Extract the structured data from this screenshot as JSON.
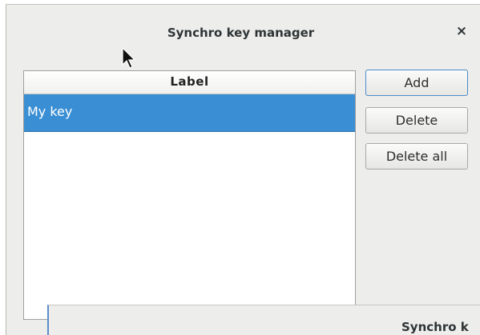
{
  "dialog": {
    "title": "Synchro key manager",
    "close_glyph": "×"
  },
  "list": {
    "header": "Label",
    "rows": [
      {
        "label": "My key",
        "selected": true
      }
    ]
  },
  "buttons": {
    "add": "Add",
    "delete": "Delete",
    "delete_all": "Delete all"
  },
  "second_dialog": {
    "title_partial": "Synchro k"
  },
  "icons": {
    "close": "close-icon",
    "cursor": "mouse-pointer-icon"
  },
  "colors": {
    "selection": "#3a8fd4",
    "focus_border": "#4a8ac9",
    "dialog_bg": "#ededeb"
  }
}
